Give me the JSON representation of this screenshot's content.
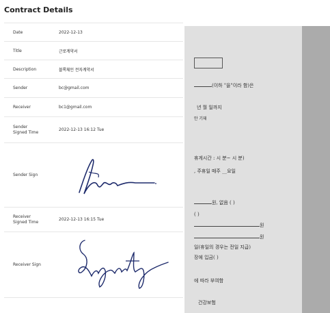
{
  "header": {
    "title": "Contract Details"
  },
  "rows": [
    {
      "label": "Date",
      "value": "2022-12-13"
    },
    {
      "label": "Title",
      "value": "근로계약서"
    },
    {
      "label": "Description",
      "value": "블록체인 전자계약서"
    },
    {
      "label": "Sender",
      "value": "bc@gmail.com"
    },
    {
      "label": "Receiver",
      "value": "bc1@gmail.com"
    },
    {
      "label": "Sender\nSigned Time",
      "value": "2022-12-13 16:12 Tue"
    },
    {
      "label": "Sender Sign",
      "value": ""
    },
    {
      "label": "Receiver\nSigned Time",
      "value": "2022-12-13 16:15 Tue"
    },
    {
      "label": "Receiver Sign",
      "value": ""
    }
  ],
  "document": {
    "lines": [
      "(이하 \"을\"이라 함)은",
      "년   월   일까지",
      "만 기재",
      "휴게시간 : 시 분~ 시  분)",
      ", 주휴일 매주 __요일",
      "원,  없음 (    )",
      "(    )",
      "원",
      "원",
      "일(휴일의 경우는 전일 지급)",
      "장에 입금(    )",
      "에 따라 부여함",
      "건강보험"
    ]
  },
  "colors": {
    "panel_bg": "#ababab",
    "page_bg": "#e0e0e0",
    "border": "#e6e6e6"
  }
}
